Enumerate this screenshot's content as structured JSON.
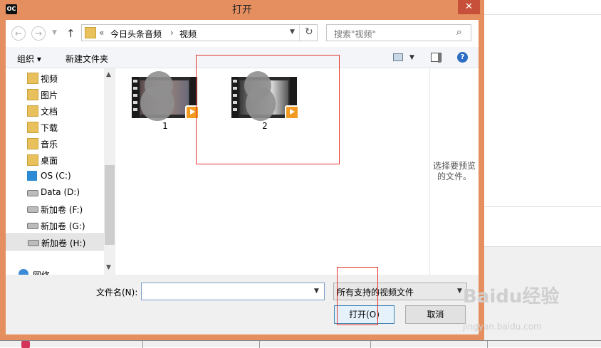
{
  "window": {
    "title": "打开",
    "close_symbol": "✕",
    "app_icon_text": "OC"
  },
  "nav": {
    "back_symbol": "←",
    "forward_symbol": "→",
    "up_symbol": "↑",
    "address": {
      "overflow": "«",
      "crumb1": "今日头条音频",
      "separator": "›",
      "crumb2": "视频"
    },
    "search_placeholder": "搜索\"视频\""
  },
  "toolbar": {
    "organize_label": "组织 ▾",
    "new_folder_label": "新建文件夹",
    "help_symbol": "?"
  },
  "sidebar": {
    "items": [
      {
        "label": "视频",
        "icon": "video-folder-icon"
      },
      {
        "label": "图片",
        "icon": "pictures-folder-icon"
      },
      {
        "label": "文档",
        "icon": "documents-folder-icon"
      },
      {
        "label": "下载",
        "icon": "downloads-folder-icon"
      },
      {
        "label": "音乐",
        "icon": "music-folder-icon"
      },
      {
        "label": "桌面",
        "icon": "desktop-folder-icon"
      },
      {
        "label": "OS (C:)",
        "icon": "windows-drive-icon"
      },
      {
        "label": "Data (D:)",
        "icon": "drive-icon"
      },
      {
        "label": "新加卷 (F:)",
        "icon": "drive-icon"
      },
      {
        "label": "新加卷 (G:)",
        "icon": "drive-icon"
      },
      {
        "label": "新加卷 (H:)",
        "icon": "drive-icon"
      },
      {
        "label": "网络",
        "icon": "network-icon"
      }
    ]
  },
  "files": [
    {
      "name": "1"
    },
    {
      "name": "2"
    }
  ],
  "preview": {
    "line1": "选择要预览",
    "line2": "的文件。"
  },
  "footer": {
    "filename_label": "文件名(N):",
    "filename_value": "",
    "filter_value": "所有支持的视频文件",
    "open_label": "打开(O)",
    "cancel_label": "取消"
  },
  "watermark": {
    "brand": "Baidu经验",
    "url": "jingyan.baidu.com"
  },
  "colors": {
    "frame": "#e58f60",
    "close": "#c7503a",
    "highlight": "#e2352d",
    "accent_play": "#f39a21"
  }
}
